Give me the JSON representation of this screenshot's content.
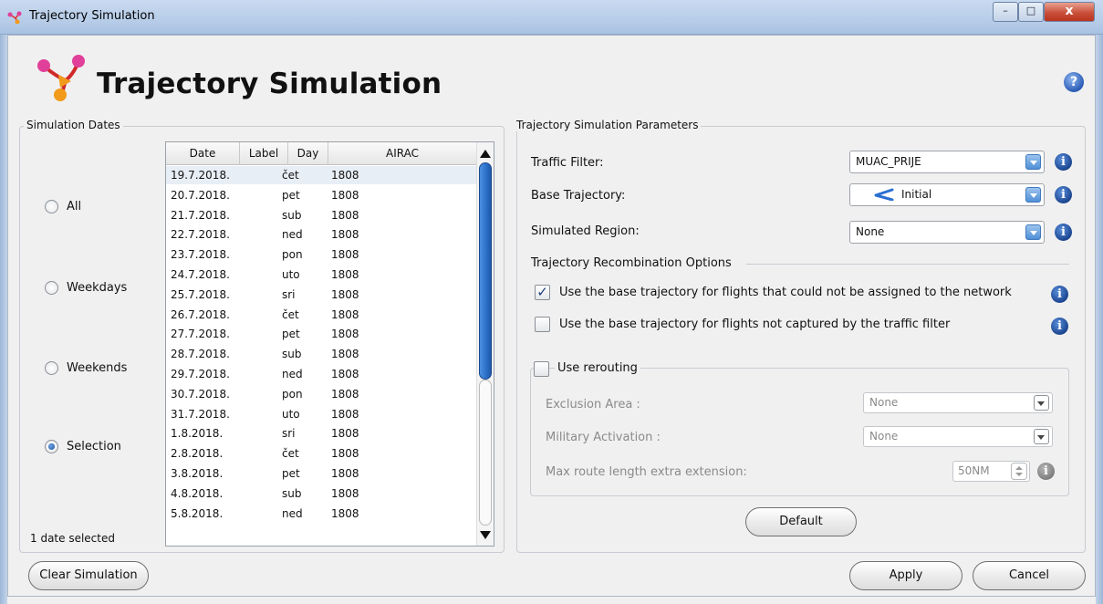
{
  "window": {
    "title": "Trajectory Simulation",
    "minimize_glyph": "–",
    "maximize_glyph": "□",
    "close_glyph": "x"
  },
  "header": {
    "title": "Trajectory Simulation",
    "help_glyph": "?"
  },
  "dates_group": {
    "title": "Simulation Dates",
    "options": [
      {
        "label": "All",
        "checked": false
      },
      {
        "label": "Weekdays",
        "checked": false
      },
      {
        "label": "Weekends",
        "checked": false
      },
      {
        "label": "Selection",
        "checked": true
      }
    ],
    "selection_status": "1 date selected"
  },
  "table": {
    "columns": [
      "Date",
      "Label",
      "Day",
      "AIRAC"
    ],
    "rows": [
      {
        "date": "19.7.2018.",
        "label": "",
        "day": "čet",
        "airac": "1808",
        "selected": true
      },
      {
        "date": "20.7.2018.",
        "label": "",
        "day": "pet",
        "airac": "1808"
      },
      {
        "date": "21.7.2018.",
        "label": "",
        "day": "sub",
        "airac": "1808"
      },
      {
        "date": "22.7.2018.",
        "label": "",
        "day": "ned",
        "airac": "1808"
      },
      {
        "date": "23.7.2018.",
        "label": "",
        "day": "pon",
        "airac": "1808"
      },
      {
        "date": "24.7.2018.",
        "label": "",
        "day": "uto",
        "airac": "1808"
      },
      {
        "date": "25.7.2018.",
        "label": "",
        "day": "sri",
        "airac": "1808"
      },
      {
        "date": "26.7.2018.",
        "label": "",
        "day": "čet",
        "airac": "1808"
      },
      {
        "date": "27.7.2018.",
        "label": "",
        "day": "pet",
        "airac": "1808"
      },
      {
        "date": "28.7.2018.",
        "label": "",
        "day": "sub",
        "airac": "1808"
      },
      {
        "date": "29.7.2018.",
        "label": "",
        "day": "ned",
        "airac": "1808"
      },
      {
        "date": "30.7.2018.",
        "label": "",
        "day": "pon",
        "airac": "1808"
      },
      {
        "date": "31.7.2018.",
        "label": "",
        "day": "uto",
        "airac": "1808"
      },
      {
        "date": "1.8.2018.",
        "label": "",
        "day": "sri",
        "airac": "1808"
      },
      {
        "date": "2.8.2018.",
        "label": "",
        "day": "čet",
        "airac": "1808"
      },
      {
        "date": "3.8.2018.",
        "label": "",
        "day": "pet",
        "airac": "1808"
      },
      {
        "date": "4.8.2018.",
        "label": "",
        "day": "sub",
        "airac": "1808"
      },
      {
        "date": "5.8.2018.",
        "label": "",
        "day": "ned",
        "airac": "1808"
      }
    ]
  },
  "params": {
    "title": "Trajectory Simulation Parameters",
    "traffic_filter_label": "Traffic Filter:",
    "traffic_filter_value": "MUAC_PRIJE",
    "base_trajectory_label": "Base Trajectory:",
    "base_trajectory_value": "Initial",
    "simulated_region_label": "Simulated Region:",
    "simulated_region_value": "None",
    "recombination_title": "Trajectory Recombination Options",
    "opt_unassigned_label": "Use the base trajectory for flights that could not be assigned to the network",
    "opt_unassigned_checked": true,
    "opt_not_captured_label": "Use the base trajectory for flights not captured by the traffic filter",
    "opt_not_captured_checked": false,
    "rerouting": {
      "label": "Use rerouting",
      "checked": false,
      "exclusion_area_label": "Exclusion Area :",
      "exclusion_area_value": "None",
      "military_activation_label": "Military Activation :",
      "military_activation_value": "None",
      "max_route_label": "Max route length extra extension:",
      "max_route_value": "50NM"
    },
    "default_button": "Default",
    "info_glyph": "i"
  },
  "footer": {
    "clear_button": "Clear Simulation",
    "apply_button": "Apply",
    "cancel_button": "Cancel"
  },
  "colors": {
    "accent_blue": "#2c6fc8",
    "icon_pink": "#e0409a",
    "icon_orange": "#f29a1a"
  }
}
